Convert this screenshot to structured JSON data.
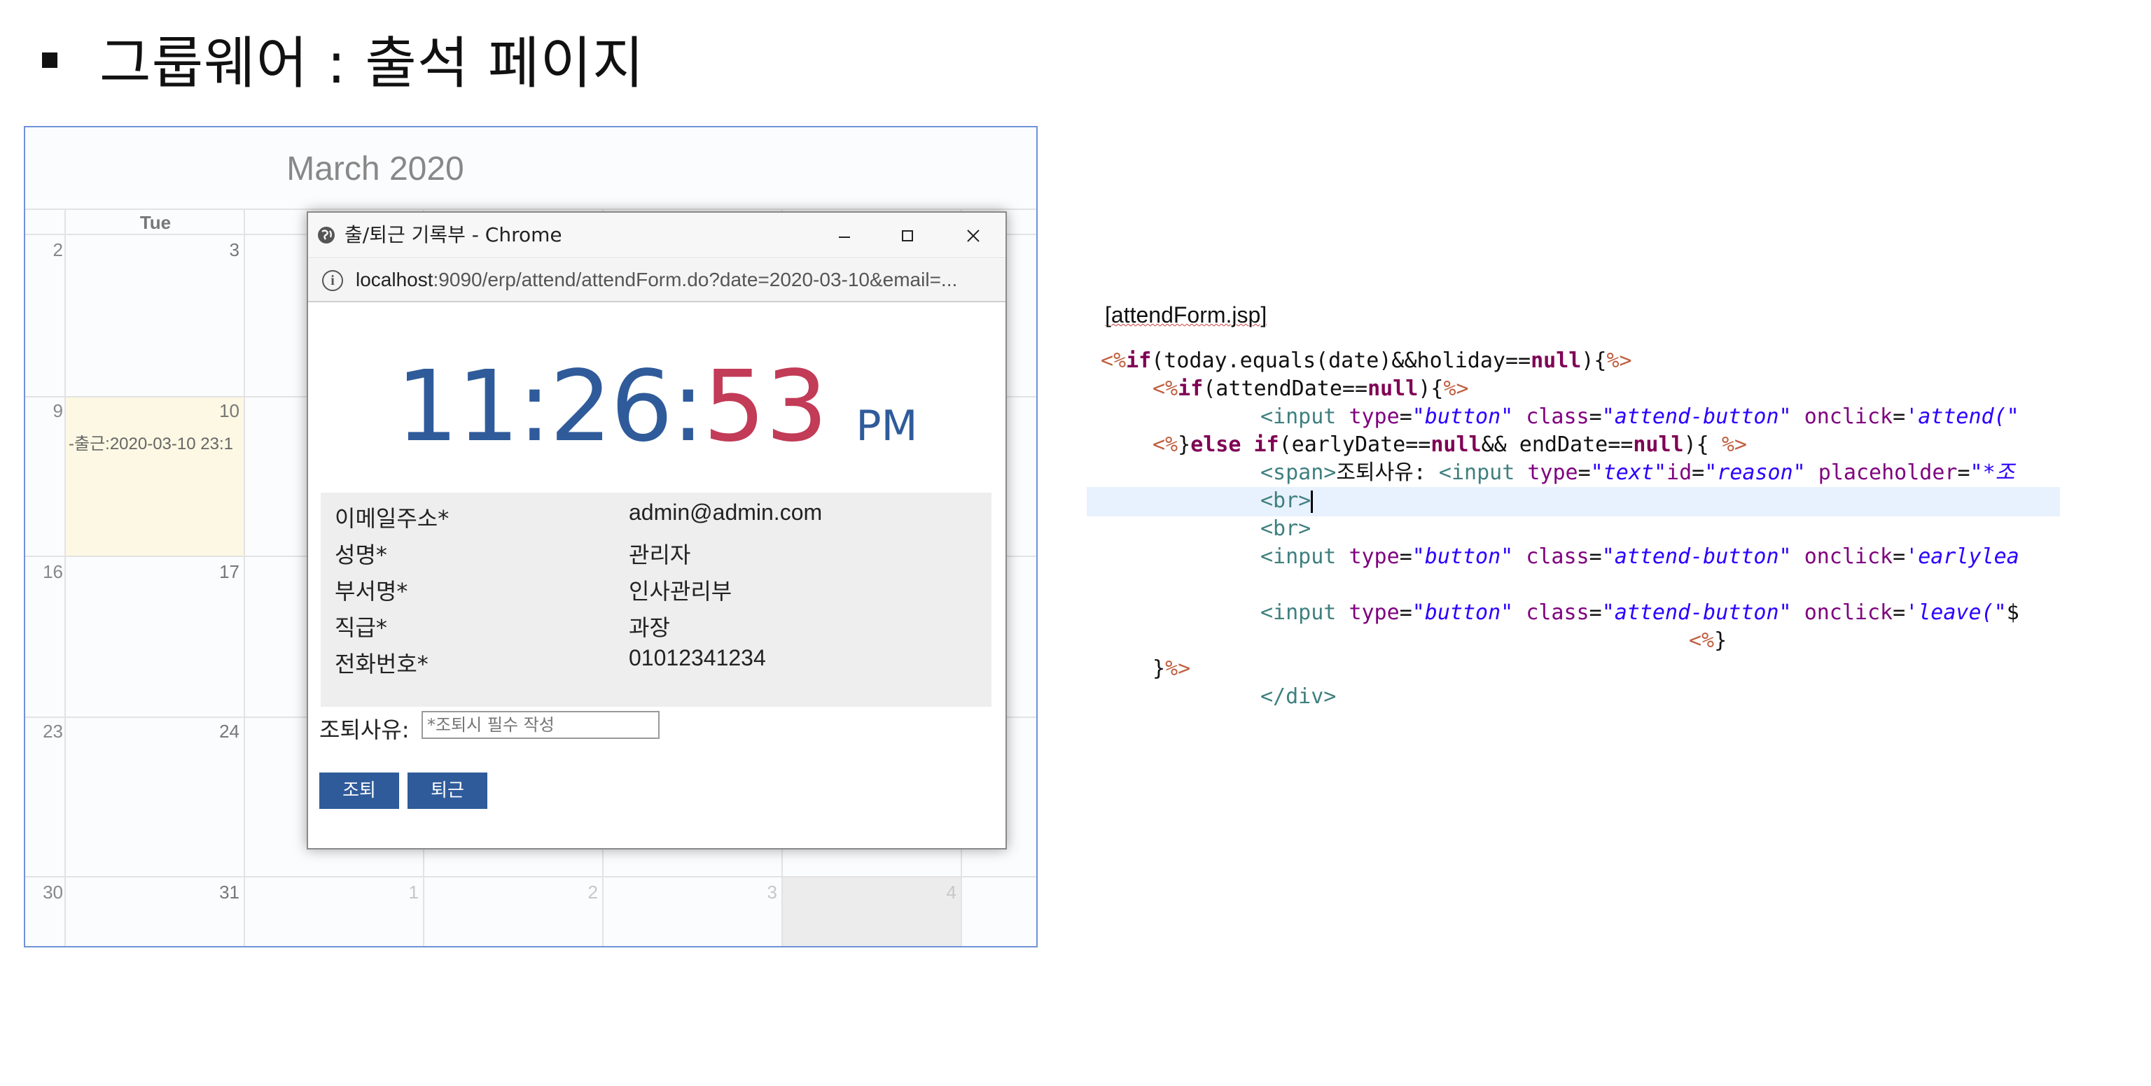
{
  "slide": {
    "title": "그룹웨어 : 출석 페이지"
  },
  "calendar": {
    "month_title": "March 2020",
    "day_header": "Tue",
    "weeks": [
      {
        "week": "2",
        "tue": "3"
      },
      {
        "week": "9",
        "tue": "10"
      },
      {
        "week": "16",
        "tue": "17"
      },
      {
        "week": "23",
        "tue": "24"
      },
      {
        "week": "30",
        "tue": "31",
        "others": [
          "1",
          "2",
          "3",
          "4"
        ]
      }
    ],
    "event_text": "-출근:2020-03-10 23:1"
  },
  "popup": {
    "window_title": "출/퇴근 기록부 - Chrome",
    "url_host": "localhost",
    "url_rest": ":9090/erp/attend/attendForm.do?date=2020-03-10&email=...",
    "clock": {
      "hm": "11:26:",
      "sec": "53",
      "ampm": "PM"
    },
    "fields": [
      {
        "label": "이메일주소*",
        "value": "admin@admin.com"
      },
      {
        "label": "성명*",
        "value": "관리자"
      },
      {
        "label": "부서명*",
        "value": "인사관리부"
      },
      {
        "label": "직급*",
        "value": "과장"
      },
      {
        "label": "전화번호*",
        "value": "01012341234"
      }
    ],
    "reason_label": "조퇴사유:",
    "reason_placeholder": "*조퇴시 필수 작성",
    "early_button": "조퇴",
    "leave_button": "퇴근"
  },
  "code": {
    "caption": "[attendForm.jsp]",
    "lines": [
      "<%if(today.equals(date)&&holiday==null){%>",
      "<%if(attendDate==null){%>",
      "<input type=\"button\" class=\"attend-button\" onclick='attend(\"",
      "<%}else if(earlyDate==null&& endDate==null){ %>",
      "<span>조퇴사유: <input type=\"text\"id=\"reason\" placeholder=\"*조",
      "<br>",
      "<br>",
      "<input type=\"button\" class=\"attend-button\" onclick='earlylea",
      "<input type=\"button\" class=\"attend-button\" onclick='leave(\"$",
      "<%}",
      "}%>",
      "</div>"
    ]
  }
}
